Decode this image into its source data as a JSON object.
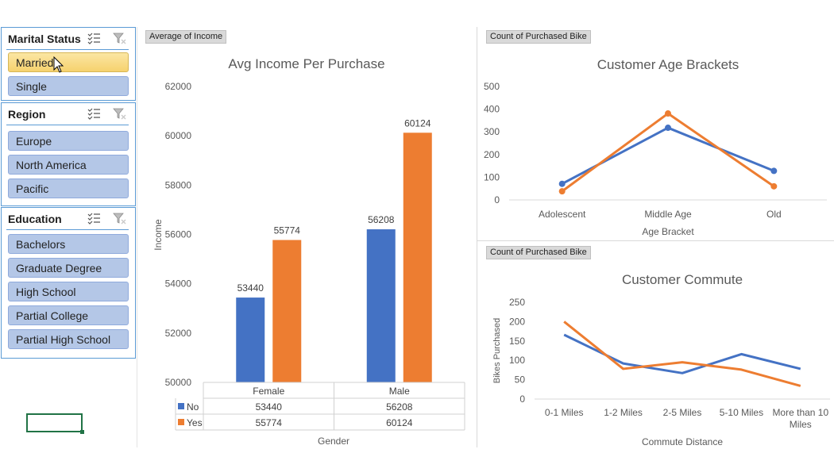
{
  "slicers": {
    "marital": {
      "title": "Marital Status",
      "items": [
        {
          "label": "Married",
          "selected": true
        },
        {
          "label": "Single",
          "selected": false
        }
      ]
    },
    "region": {
      "title": "Region",
      "items": [
        {
          "label": "Europe"
        },
        {
          "label": "North America"
        },
        {
          "label": "Pacific"
        }
      ]
    },
    "education": {
      "title": "Education",
      "items": [
        {
          "label": "Bachelors"
        },
        {
          "label": "Graduate Degree"
        },
        {
          "label": "High School"
        },
        {
          "label": "Partial College"
        },
        {
          "label": "Partial High School"
        }
      ]
    },
    "icons": {
      "multiselect": "multi-select-icon",
      "clear": "clear-filter-icon"
    }
  },
  "colors": {
    "no": "#4472c4",
    "yes": "#ed7d31",
    "accent": "#5b9bd5",
    "slicer_item": "#b4c7e7",
    "selected_item": "#f6d26e"
  },
  "chart_data": [
    {
      "type": "bar",
      "field_button": "Average of Income",
      "title": "Avg Income Per Purchase",
      "xlabel": "Gender",
      "ylabel": "Income",
      "categories": [
        "Female",
        "Male"
      ],
      "series": [
        {
          "name": "No",
          "values": [
            53440,
            56208
          ]
        },
        {
          "name": "Yes",
          "values": [
            55774,
            60124
          ]
        }
      ],
      "ylim": [
        50000,
        62000
      ],
      "yticks": [
        50000,
        52000,
        54000,
        56000,
        58000,
        60000,
        62000
      ],
      "data_table": true
    },
    {
      "type": "line",
      "field_button": "Count of Purchased Bike",
      "title": "Customer Age Brackets",
      "xlabel": "Age Bracket",
      "ylabel": "",
      "categories": [
        "Adolescent",
        "Middle Age",
        "Old"
      ],
      "series": [
        {
          "name": "No",
          "values": [
            71,
            318,
            128
          ]
        },
        {
          "name": "Yes",
          "values": [
            38,
            381,
            60
          ]
        }
      ],
      "ylim": [
        0,
        500
      ],
      "yticks": [
        0,
        100,
        200,
        300,
        400,
        500
      ],
      "markers": true
    },
    {
      "type": "line",
      "field_button": "Count of Purchased Bike",
      "title": "Customer Commute",
      "xlabel": "Commute Distance",
      "ylabel": "Bikes Purchased",
      "categories": [
        "0-1 Miles",
        "1-2 Miles",
        "2-5 Miles",
        "5-10 Miles",
        "More than 10 Miles"
      ],
      "series": [
        {
          "name": "No",
          "values": [
            166,
            92,
            67,
            116,
            78
          ]
        },
        {
          "name": "Yes",
          "values": [
            200,
            78,
            95,
            76,
            34
          ]
        }
      ],
      "ylim": [
        0,
        250
      ],
      "yticks": [
        0,
        50,
        100,
        150,
        200,
        250
      ],
      "markers": false
    }
  ]
}
